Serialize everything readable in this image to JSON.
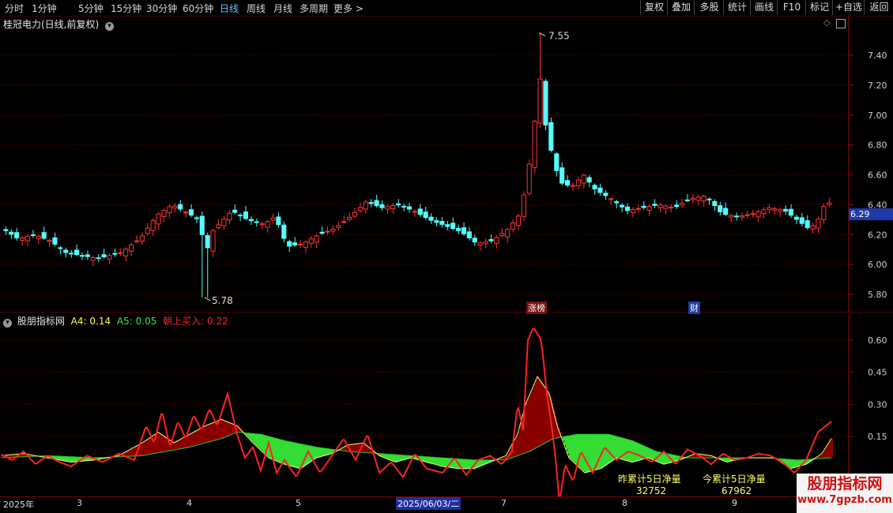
{
  "toolbar": {
    "timeframes": [
      "分时",
      "1分钟",
      "5分钟",
      "15分钟",
      "30分钟",
      "60分钟",
      "日线",
      "周线",
      "月线",
      "多周期",
      "更多 >"
    ],
    "active": "日线",
    "buttons": [
      "复权",
      "叠加",
      "多股",
      "统计",
      "画线",
      "F10",
      "标记",
      "+自选",
      "返回"
    ]
  },
  "main_chart": {
    "title": "桂冠电力(日线,前复权)",
    "current_price": "6.29",
    "y_ticks": [
      "7.40",
      "7.20",
      "7.00",
      "6.80",
      "6.60",
      "6.40",
      "6.20",
      "6.00",
      "5.80"
    ],
    "high_label": "7.55",
    "low_label": "5.78",
    "event_tags": [
      "涨榜",
      "财"
    ]
  },
  "indicator": {
    "name": "股朋指标网",
    "a4_label": "A4: 0.14",
    "a5_label": "A5: 0.05",
    "buy_label": "朝上买入: 0.22",
    "y_ticks": [
      "0.60",
      "0.45",
      "0.30",
      "0.15"
    ],
    "yesterday_label": "昨累计5日净量",
    "yesterday_value": "32752",
    "today_label": "今累计5日净量",
    "today_value": "67962"
  },
  "x_axis": {
    "labels": [
      "2025年",
      "3",
      "4",
      "5",
      "2025/06/03/二",
      "7",
      "8",
      "9"
    ]
  },
  "watermark": {
    "title": "股朋指标网",
    "url": "www.7gpzb.com"
  },
  "colors": {
    "up": "#ff3333",
    "down": "#54ffff",
    "grid": "#550000",
    "a4": "#ffff33",
    "a5": "#33ee33",
    "buy": "#ff2222",
    "accent": "#5cc8ff"
  }
}
